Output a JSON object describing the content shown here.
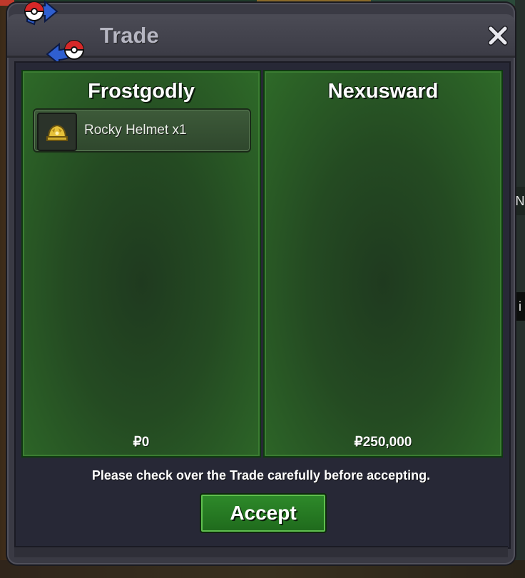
{
  "window": {
    "title": "Trade",
    "close_icon": "close-icon"
  },
  "left_panel": {
    "player_name": "Frostgodly",
    "items": [
      {
        "icon": "helmet-icon",
        "label": "Rocky Helmet  x1"
      }
    ],
    "money": "₽0"
  },
  "right_panel": {
    "player_name": "Nexusward",
    "items": [],
    "money": "₽250,000"
  },
  "notice": "Please check over the Trade carefully before accepting.",
  "buttons": {
    "accept_label": "Accept"
  },
  "background": {
    "right_tag_1": "N",
    "right_tag_2": "i"
  },
  "colors": {
    "panel_green": "#2e6a28",
    "button_green": "#2e8a2a",
    "dialog_gray": "#3a3a44",
    "title_text": "#b6b6c2"
  }
}
